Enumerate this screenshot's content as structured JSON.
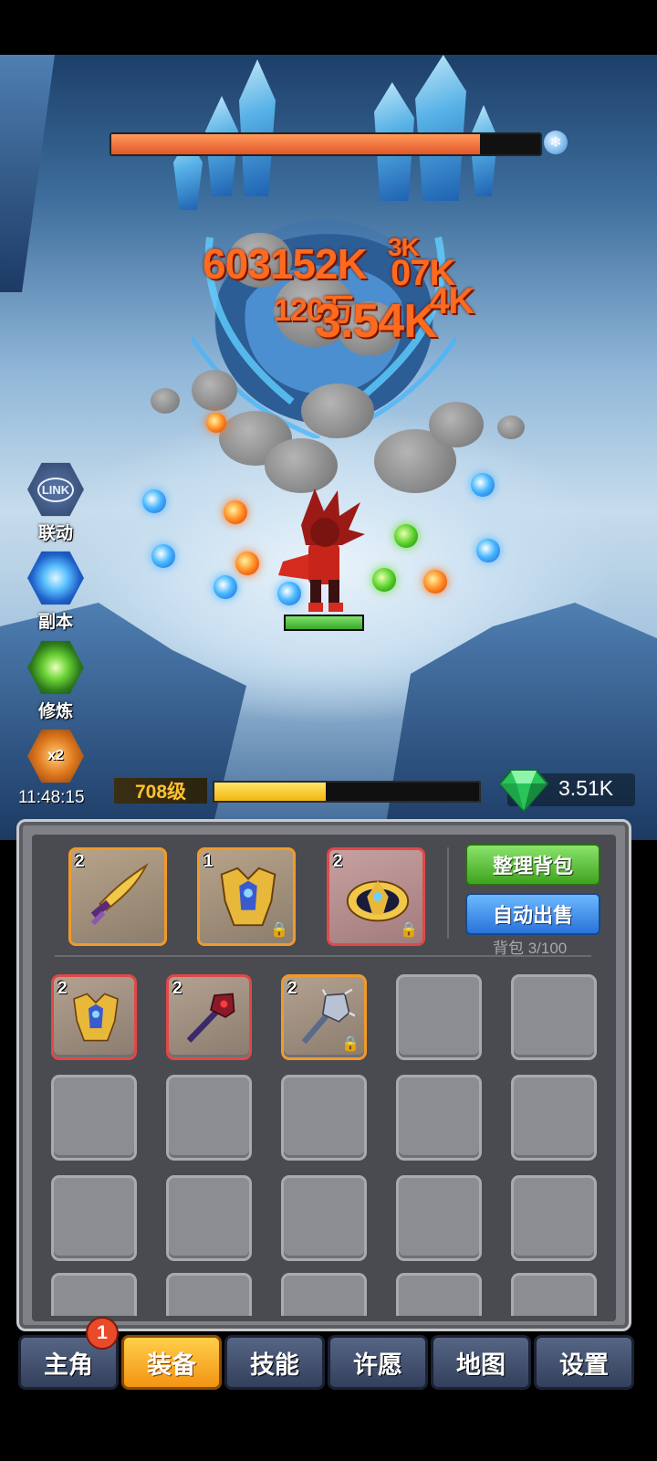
{
  "boss": {
    "hp_fraction": 0.86
  },
  "damage_numbers": [
    "603152K",
    "3K",
    "07K",
    "120万",
    "3.54K",
    "4K"
  ],
  "side_menu": [
    {
      "label": "联动",
      "icon": "link-icon"
    },
    {
      "label": "副本",
      "icon": "vortex-icon"
    },
    {
      "label": "修炼",
      "icon": "training-icon"
    },
    {
      "label": "x2",
      "icon": "double-speed-icon"
    }
  ],
  "countdown": "11:48:15",
  "player": {
    "level": "708级",
    "xp_fraction": 0.42,
    "hp_fraction": 1.0
  },
  "currency": {
    "gems": "3.51K"
  },
  "inventory": {
    "equipped": [
      {
        "count": "2",
        "item": "golden-blade",
        "locked": false,
        "rarity": "orange"
      },
      {
        "count": "1",
        "item": "golden-armor",
        "locked": true,
        "rarity": "orange"
      },
      {
        "count": "2",
        "item": "golden-crown",
        "locked": true,
        "rarity": "red"
      }
    ],
    "actions": {
      "sort": "整理背包",
      "auto_sell": "自动出售"
    },
    "capacity": "背包 3/100",
    "bag": [
      {
        "count": "2",
        "item": "golden-armor",
        "rarity": "red",
        "locked": false
      },
      {
        "count": "2",
        "item": "dark-staff",
        "rarity": "red",
        "locked": false
      },
      {
        "count": "2",
        "item": "spiked-mace",
        "rarity": "orange",
        "locked": true
      }
    ]
  },
  "nav": {
    "badge": "1",
    "tabs": [
      "主角",
      "装备",
      "技能",
      "许愿",
      "地图",
      "设置"
    ],
    "active": "装备"
  }
}
